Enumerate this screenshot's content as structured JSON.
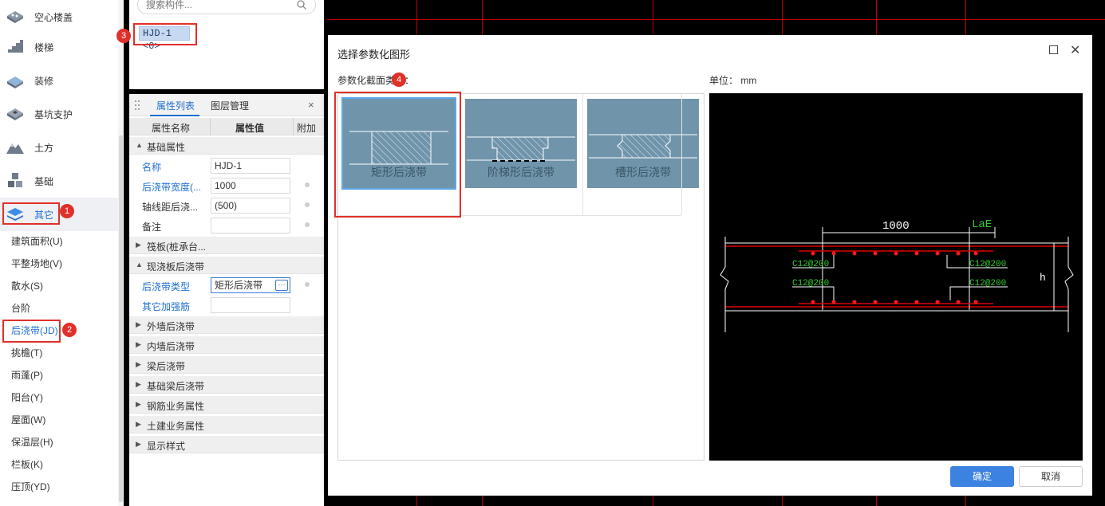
{
  "nav": {
    "categories": [
      {
        "label": "空心楼盖",
        "icon": "hollow-floor-icon"
      },
      {
        "label": "楼梯",
        "icon": "stairs-icon"
      },
      {
        "label": "装修",
        "icon": "decoration-icon"
      },
      {
        "label": "基坑支护",
        "icon": "pit-support-icon"
      },
      {
        "label": "土方",
        "icon": "earthwork-icon"
      },
      {
        "label": "基础",
        "icon": "foundation-icon"
      },
      {
        "label": "其它",
        "icon": "other-layers-icon"
      }
    ],
    "sub_items": [
      "建筑面积(U)",
      "平整场地(V)",
      "散水(S)",
      "台阶",
      "后浇带(JD)",
      "挑檐(T)",
      "雨蓬(P)",
      "阳台(Y)",
      "屋面(W)",
      "保温层(H)",
      "栏板(K)",
      "压顶(YD)"
    ]
  },
  "component_list": {
    "search_placeholder": "搜索构件...",
    "selected_item": "HJD-1 <0>"
  },
  "properties": {
    "tab_attributes": "属性列表",
    "tab_layers": "图层管理",
    "close_glyph": "×",
    "col_name": "属性名称",
    "col_value": "属性值",
    "col_extra": "附加",
    "groups": {
      "basic": "基础属性",
      "raft": "筏板(桩承台...",
      "cast_slab": "现浇板后浇带",
      "ext_wall": "外墙后浇带",
      "int_wall": "内墙后浇带",
      "beam": "梁后浇带",
      "found_beam": "基础梁后浇带",
      "rebar_biz": "钢筋业务属性",
      "civil_biz": "土建业务属性",
      "display": "显示样式"
    },
    "rows": {
      "name_label": "名称",
      "name_value": "HJD-1",
      "width_label": "后浇带宽度(...",
      "width_value": "1000",
      "offset_label": "轴线距后浇...",
      "offset_value": "(500)",
      "note_label": "备注",
      "note_value": "",
      "type_label": "后浇带类型",
      "type_value": "矩形后浇带",
      "type_more": "···",
      "extra_rebar_label": "其它加强筋",
      "extra_rebar_value": ""
    }
  },
  "dialog": {
    "title": "选择参数化图形",
    "section_label": "参数化截面类型：",
    "unit_label": "单位：  mm",
    "shapes": [
      "矩形后浇带",
      "阶梯形后浇带",
      "槽形后浇带"
    ],
    "selected_shape": "矩形后浇带",
    "preview": {
      "width_dim": "1000",
      "lae_label": "LaE",
      "rebar_top_left": "C12@200",
      "rebar_top_right": "C12@200",
      "rebar_bot_left": "C12@200",
      "rebar_bot_right": "C12@200",
      "h_label": "h"
    },
    "ok_label": "确定",
    "cancel_label": "取消"
  },
  "annotations": [
    "1",
    "2",
    "3",
    "4"
  ],
  "colors": {
    "accent": "#1f6fd1",
    "annotation": "#e0302a",
    "cad_red": "#c00000",
    "cad_green": "#33cc33",
    "card_bg": "#7095ab"
  }
}
